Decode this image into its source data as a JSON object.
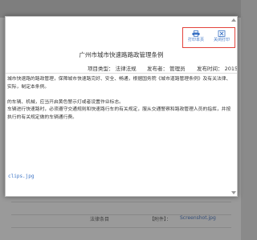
{
  "modal": {
    "toolbar": {
      "print_label": "打印本页",
      "close_label": "关闭打印"
    },
    "title": "广州市城市快速路路政管理条例",
    "meta": {
      "category": "项目类型：  法律法规",
      "publisher": "发布者：  管理员",
      "time": "发布时间：  2015-"
    },
    "body_lines": [
      "城市快速路的路政管理，保障城市快速路完好、安全、畅通，根据国务院《城市道路管理条例》及有关法律、",
      "实际，制定本条例。",
      "",
      "的车辆、机械，应当开启黄色警示灯或者设置作业标志。",
      "车辆进行快速路时，必须遵守交通规则和快速路行车的有关规定，服从交通警察和路政管理人员的指挥，并按",
      "执行的有关规定做的车辆通行费。"
    ],
    "attachment": "clips.jpg"
  },
  "background": {
    "row_label": "法律条目",
    "row_attachment": "【附件】：",
    "row_file": "Screenshot.jpg"
  }
}
